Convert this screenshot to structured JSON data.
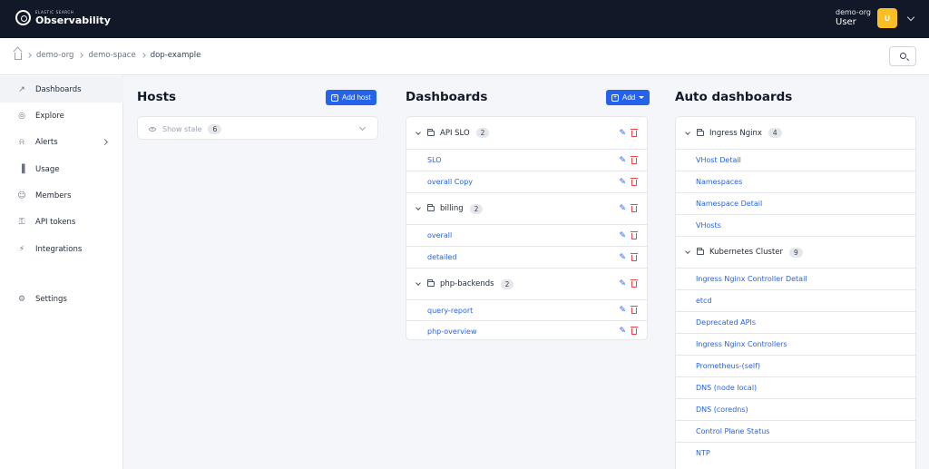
{
  "header": {
    "logo_small": "ELASTIC SEARCH",
    "logo_text": "Observability",
    "org": "demo-org",
    "user": "User",
    "avatar_initial": "U"
  },
  "breadcrumb": [
    "demo-org",
    "demo-space",
    "dop-example"
  ],
  "sidebar": {
    "items": [
      {
        "label": "Dashboards",
        "icon": "chart-line-icon"
      },
      {
        "label": "Explore",
        "icon": "globe-icon"
      },
      {
        "label": "Alerts",
        "icon": "bell-icon"
      },
      {
        "label": "Usage",
        "icon": "bar-chart-icon"
      },
      {
        "label": "Members",
        "icon": "users-icon"
      },
      {
        "label": "API tokens",
        "icon": "key-icon"
      },
      {
        "label": "Integrations",
        "icon": "plug-icon"
      },
      {
        "label": "Settings",
        "icon": "gear-icon"
      }
    ]
  },
  "hosts": {
    "title": "Hosts",
    "add_label": "Add host",
    "show_stale_label": "Show stale",
    "stale_count": "6"
  },
  "dashboards": {
    "title": "Dashboards",
    "add_label": "Add",
    "folders": [
      {
        "name": "API SLO",
        "count": "2",
        "items": [
          "SLO",
          "overall Copy"
        ]
      },
      {
        "name": "billing",
        "count": "2",
        "items": [
          "overall",
          "detailed"
        ]
      },
      {
        "name": "php-backends",
        "count": "2",
        "items": [
          "query-report",
          "php-overview"
        ]
      }
    ]
  },
  "auto_dashboards": {
    "title": "Auto dashboards",
    "folders": [
      {
        "name": "Ingress Nginx",
        "count": "4",
        "items": [
          "VHost Detail",
          "Namespaces",
          "Namespace Detail",
          "VHosts"
        ]
      },
      {
        "name": "Kubernetes Cluster",
        "count": "9",
        "items": [
          "Ingress Nginx Controller Detail",
          "etcd",
          "Deprecated APIs",
          "Ingress Nginx Controllers",
          "Prometheus-(self)",
          "DNS (node local)",
          "DNS (coredns)",
          "Control Plane Status",
          "NTP"
        ]
      }
    ]
  },
  "colors": {
    "accent": "#2563eb",
    "topbar": "#111827",
    "avatar": "#fbbf24",
    "danger": "#ef4444"
  }
}
